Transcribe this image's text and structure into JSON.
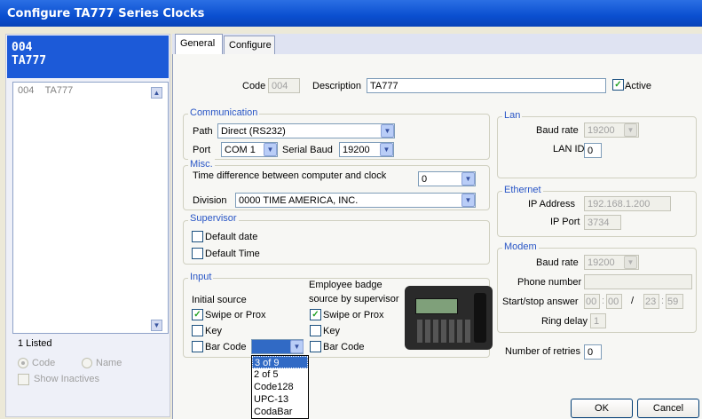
{
  "window": {
    "title": "Configure TA777 Series Clocks"
  },
  "sidebar": {
    "code": "004",
    "name": "TA777",
    "list_code": "004",
    "list_name": "TA777",
    "count": "1 Listed",
    "radio_code": "Code",
    "radio_name": "Name",
    "show_inactives": "Show Inactives"
  },
  "tabs": [
    {
      "label": "General"
    },
    {
      "label": "Configure"
    }
  ],
  "header": {
    "code_label": "Code",
    "code_value": "004",
    "desc_label": "Description",
    "desc_value": "TA777",
    "active_label": "Active"
  },
  "comm": {
    "legend": "Communication",
    "path_label": "Path",
    "path_value": "Direct (RS232)",
    "port_label": "Port",
    "port_value": "COM 1",
    "baud_label": "Serial Baud",
    "baud_value": "19200"
  },
  "misc": {
    "legend": "Misc.",
    "time_diff_label": "Time difference between computer and clock",
    "time_diff_value": "0",
    "division_label": "Division",
    "division_value": "0000  TIME AMERICA, INC."
  },
  "supervisor": {
    "legend": "Supervisor",
    "default_date": "Default date",
    "default_time": "Default Time"
  },
  "input": {
    "legend": "Input",
    "initial_source": "Initial source",
    "employee_badge_1": "Employee badge",
    "employee_badge_2": "source by supervisor",
    "swipe": "Swipe or Prox",
    "key": "Key",
    "barcode": "Bar Code",
    "swipe2": "Swipe or Prox",
    "key2": "Key",
    "barcode2": "Bar Code"
  },
  "barcode_options": [
    "3 of 9",
    "2 of 5",
    "Code128",
    "UPC-13",
    "CodaBar"
  ],
  "lan": {
    "legend": "Lan",
    "baud_label": "Baud rate",
    "baud_value": "19200",
    "lanid_label": "LAN ID",
    "lanid_value": "0"
  },
  "ethernet": {
    "legend": "Ethernet",
    "ip_label": "IP Address",
    "ip_value": "192.168.1.200",
    "port_label": "IP Port",
    "port_value": "3734"
  },
  "modem": {
    "legend": "Modem",
    "baud_label": "Baud rate",
    "baud_value": "19200",
    "phone_label": "Phone number",
    "phone_value": "",
    "startstop_label": "Start/stop answer",
    "start_h": "00",
    "start_m": "00",
    "sep": "/",
    "stop_h": "23",
    "stop_m": "59",
    "ring_label": "Ring delay",
    "ring_value": "1"
  },
  "retries": {
    "label": "Number of retries",
    "value": "0"
  },
  "buttons": {
    "ok": "OK",
    "cancel": "Cancel"
  }
}
